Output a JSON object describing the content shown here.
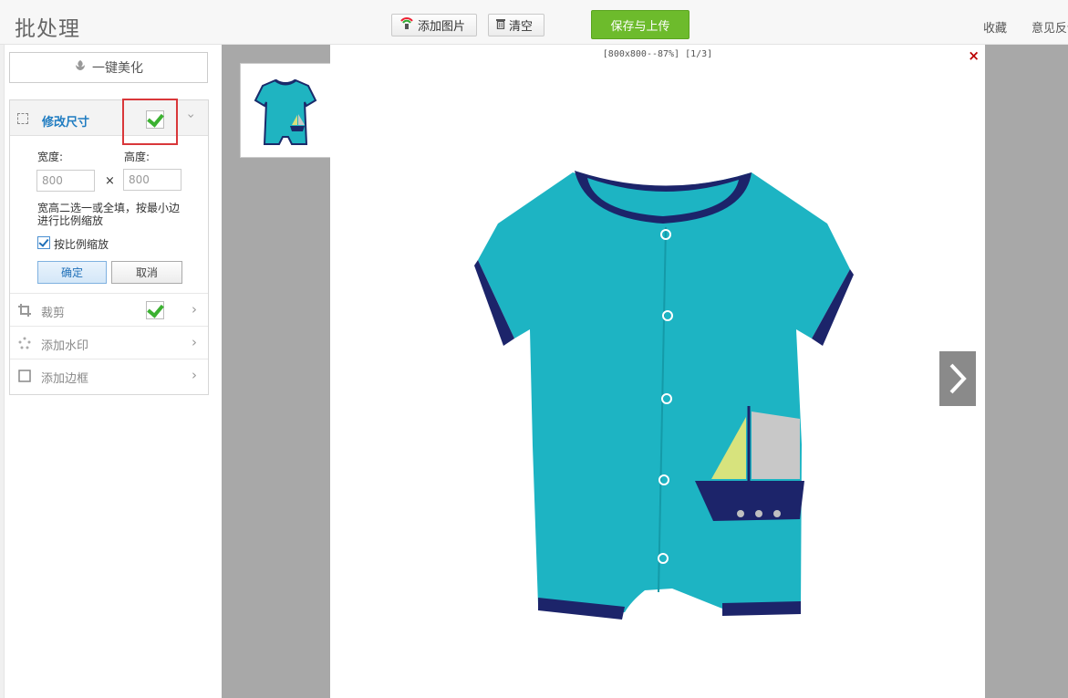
{
  "app_title": "批处理",
  "toolbar": {
    "add_image_label": "添加图片",
    "clear_label": "清空",
    "save_upload_label": "保存与上传",
    "favorite_label": "收藏",
    "feedback_label": "意见反馈"
  },
  "left_panel": {
    "beautify_label": "一键美化",
    "resize": {
      "title": "修改尺寸",
      "width_label": "宽度:",
      "height_label": "高度:",
      "width_placeholder": "800",
      "height_placeholder": "800",
      "times_sign": "×",
      "note": "宽高二选一或全填，按最小边进行比例缩放",
      "proportional_label": "按比例缩放",
      "proportional_checked": true,
      "confirm_label": "确定",
      "cancel_label": "取消"
    },
    "tools": [
      {
        "label": "裁剪",
        "enabled": true
      },
      {
        "label": "添加水印",
        "enabled": false
      },
      {
        "label": "添加边框",
        "enabled": false
      }
    ]
  },
  "preview": {
    "info": "[800x800--87%]  [1/3]",
    "close_symbol": "×"
  },
  "colors": {
    "save_button": "#6dbb2c",
    "accent_blue": "#1f7cc1",
    "highlight_red": "#d9373a",
    "check_green": "#3bb131"
  }
}
